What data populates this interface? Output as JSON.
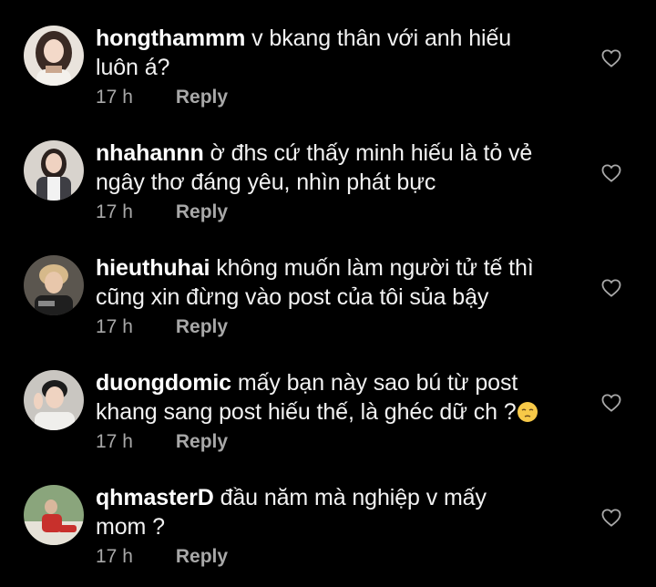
{
  "comments": [
    {
      "username": "hongthammm",
      "text": "v bkang thân với anh hiếu",
      "text2": "luôn á?",
      "time": "17 h",
      "reply": "Reply"
    },
    {
      "username": "nhahannn",
      "text": "ờ đhs cứ thấy minh hiếu là tỏ vẻ",
      "text2": "ngây thơ đáng yêu, nhìn phát bực",
      "time": "17 h",
      "reply": "Reply"
    },
    {
      "username": "hieuthuhai",
      "text": "không muốn làm người tử tế thì",
      "text2": "cũng xin đừng vào post của tôi sủa bậy",
      "time": "17 h",
      "reply": "Reply"
    },
    {
      "username": "duongdomic",
      "text": "mấy bạn này sao bú từ post",
      "text2": "khang sang post hiếu thế, là ghéc dữ ch ?",
      "time": "17 h",
      "reply": "Reply",
      "emoji": "pensive-face-emoji"
    },
    {
      "username": "qhmasterD",
      "text": "đầu năm mà nghiệp v mấy",
      "text2": "mom ?",
      "time": "17 h",
      "reply": "Reply"
    }
  ],
  "icons": {
    "like": "heart-outline-icon"
  },
  "colors": {
    "background": "#000000",
    "text": "#f5f5f5",
    "meta": "#a8a8a8"
  }
}
